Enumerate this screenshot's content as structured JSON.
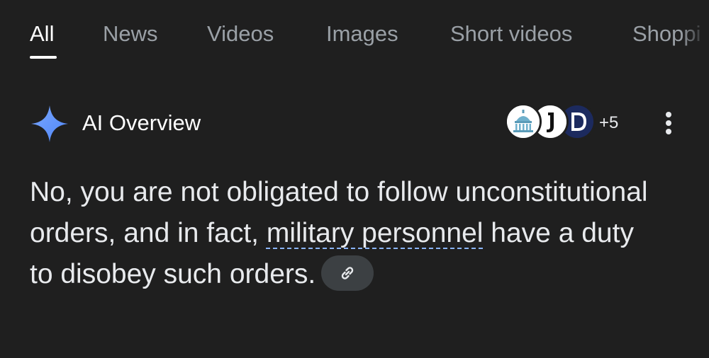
{
  "tabs": [
    {
      "label": "All",
      "active": true
    },
    {
      "label": "News",
      "active": false
    },
    {
      "label": "Videos",
      "active": false
    },
    {
      "label": "Images",
      "active": false
    },
    {
      "label": "Short videos",
      "active": false
    },
    {
      "label": "Shoppi",
      "active": false
    }
  ],
  "overview": {
    "title": "AI Overview",
    "source_count": "+5",
    "sources": [
      {
        "icon": "capitol-building-icon"
      },
      {
        "icon": "letter-j-logo-icon"
      },
      {
        "icon": "letter-d-logo-icon"
      }
    ],
    "more_icon": "vertical-dots-icon"
  },
  "answer": {
    "part1": "No, you are not obligated to follow unconstitutional orders, and in fact, ",
    "link_text": "military personnel",
    "part2": " have a duty to disobey such orders.",
    "link_icon": "link-icon"
  },
  "colors": {
    "background": "#1f1f1f",
    "text": "#e8eaed",
    "muted": "#9aa0a6",
    "accent": "#8ab4f8",
    "chip": "#3c4043"
  }
}
